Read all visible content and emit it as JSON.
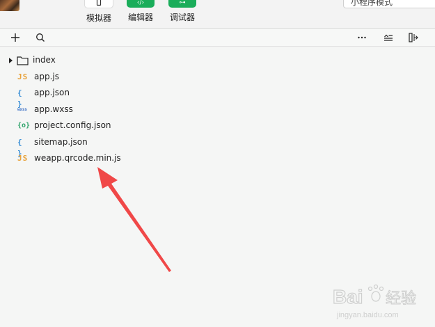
{
  "toolbar": {
    "simulator_label": "模拟器",
    "editor_label": "编辑器",
    "debugger_label": "调试器",
    "editor_glyph": "‹/›",
    "debugger_glyph": "⊶",
    "mode_label": "小程序模式"
  },
  "explorer": {
    "files": [
      {
        "icon": "folder-icon",
        "name": "index",
        "type": "folder"
      },
      {
        "icon": "js-file-icon",
        "name": "app.js",
        "type": "js",
        "glyph": "JS"
      },
      {
        "icon": "json-file-icon",
        "name": "app.json",
        "type": "json",
        "glyph": "{ }"
      },
      {
        "icon": "wxss-file-icon",
        "name": "app.wxss",
        "type": "wxss",
        "glyph": "wxss"
      },
      {
        "icon": "config-file-icon",
        "name": "project.config.json",
        "type": "config",
        "glyph": "{o}"
      },
      {
        "icon": "json-file-icon",
        "name": "sitemap.json",
        "type": "json",
        "glyph": "{ }"
      },
      {
        "icon": "js-file-icon",
        "name": "weapp.qrcode.min.js",
        "type": "js",
        "glyph": "JS"
      }
    ]
  },
  "watermark": {
    "logo_text": "Bai",
    "logo_text_cn": "经验",
    "url": "jingyan.baidu.com"
  },
  "colors": {
    "green_button": "#1aad5a",
    "arrow": "#f04848",
    "js_icon": "#e8a23a",
    "json_icon": "#3a8fd6",
    "config_icon": "#2ea36a"
  }
}
